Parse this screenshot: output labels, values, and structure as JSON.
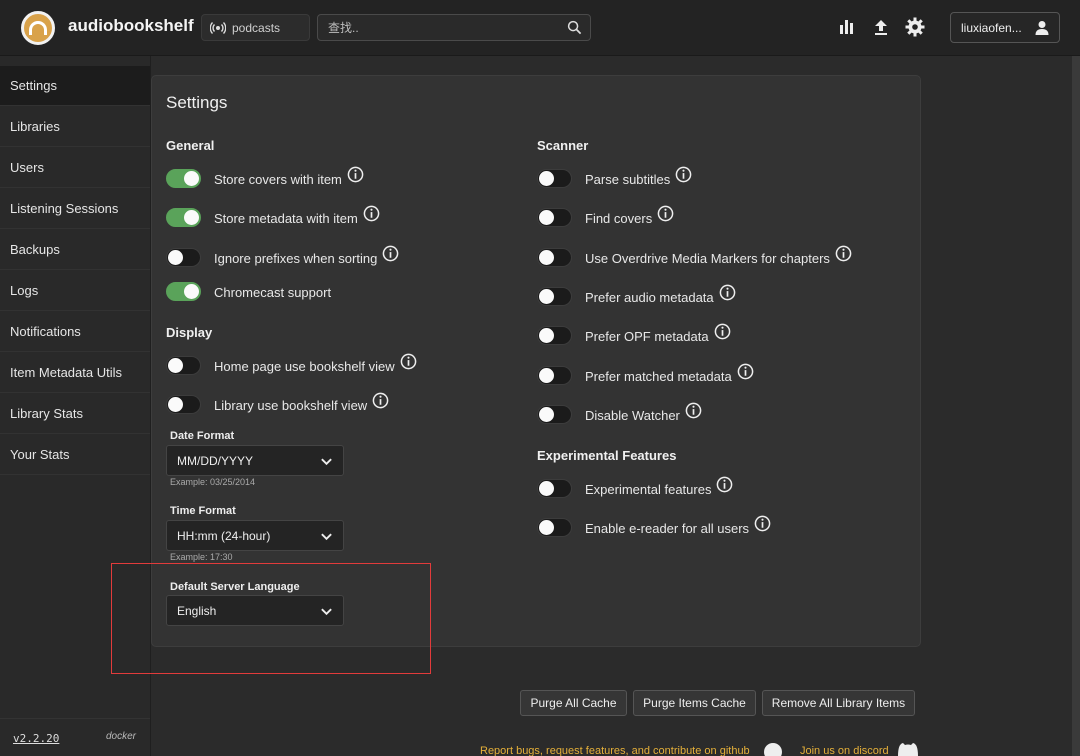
{
  "app": {
    "title": "audiobookshelf"
  },
  "header": {
    "library_label": "podcasts",
    "search_placeholder": "查找..",
    "user_name": "liuxiaofen..."
  },
  "sidebar": {
    "items": [
      {
        "label": "Settings"
      },
      {
        "label": "Libraries"
      },
      {
        "label": "Users"
      },
      {
        "label": "Listening Sessions"
      },
      {
        "label": "Backups"
      },
      {
        "label": "Logs"
      },
      {
        "label": "Notifications"
      },
      {
        "label": "Item Metadata Utils"
      },
      {
        "label": "Library Stats"
      },
      {
        "label": "Your Stats"
      }
    ],
    "version": "v2.2.20",
    "env": "docker"
  },
  "settings": {
    "title": "Settings",
    "general": {
      "title": "General",
      "toggles": [
        {
          "label": "Store covers with item",
          "on": true
        },
        {
          "label": "Store metadata with item",
          "on": true
        },
        {
          "label": "Ignore prefixes when sorting",
          "on": false
        },
        {
          "label": "Chromecast support",
          "on": true
        }
      ]
    },
    "display": {
      "title": "Display",
      "toggles": [
        {
          "label": "Home page use bookshelf view",
          "on": false
        },
        {
          "label": "Library use bookshelf view",
          "on": false
        }
      ],
      "date_format": {
        "label": "Date Format",
        "value": "MM/DD/YYYY",
        "example": "Example: 03/25/2014"
      },
      "time_format": {
        "label": "Time Format",
        "value": "HH:mm (24-hour)",
        "example": "Example: 17:30"
      },
      "language": {
        "label": "Default Server Language",
        "value": "English"
      }
    },
    "scanner": {
      "title": "Scanner",
      "toggles": [
        {
          "label": "Parse subtitles",
          "on": false
        },
        {
          "label": "Find covers",
          "on": false
        },
        {
          "label": "Use Overdrive Media Markers for chapters",
          "on": false
        },
        {
          "label": "Prefer audio metadata",
          "on": false
        },
        {
          "label": "Prefer OPF metadata",
          "on": false
        },
        {
          "label": "Prefer matched metadata",
          "on": false
        },
        {
          "label": "Disable Watcher",
          "on": false
        }
      ]
    },
    "experimental": {
      "title": "Experimental Features",
      "toggles": [
        {
          "label": "Experimental features",
          "on": false
        },
        {
          "label": "Enable e-reader for all users",
          "on": false
        }
      ]
    }
  },
  "actions": {
    "purge_all": "Purge All Cache",
    "purge_items": "Purge Items Cache",
    "remove_all": "Remove All Library Items"
  },
  "footer": {
    "github_text": "Report bugs, request features, and contribute on github",
    "discord_text": "Join us on discord"
  },
  "colors": {
    "toggle_on": "#5aa35a",
    "accent_footer": "#e5b03a",
    "highlight_box": "#e23b3b"
  }
}
